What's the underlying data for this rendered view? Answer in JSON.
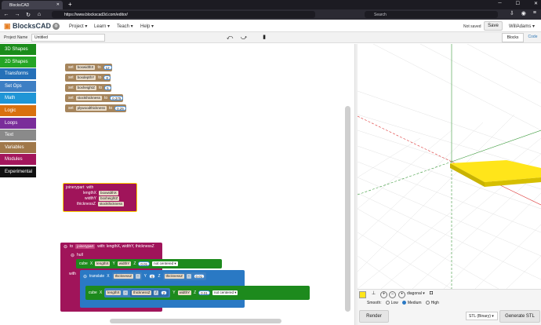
{
  "browser": {
    "tab_title": "BlocksCAD",
    "url": "https://www.blockscad3d.com/editor/",
    "search_placeholder": "Search"
  },
  "app": {
    "logo": "BlocksCAD",
    "menus": [
      "Project ▾",
      "Learn ▾",
      "Teach ▾",
      "Help ▾"
    ],
    "status": "Not saved",
    "save_label": "Save",
    "user": "WillAdams ▾",
    "project_label": "Project Name",
    "project_name": "Untitled",
    "tab_blocks": "Blocks",
    "tab_code": "Code"
  },
  "categories": [
    {
      "label": "3D Shapes",
      "color": "#1a8c1a"
    },
    {
      "label": "2D Shapes",
      "color": "#25a525"
    },
    {
      "label": "Transforms",
      "color": "#2570b8"
    },
    {
      "label": "Set Ops",
      "color": "#3e7fc4"
    },
    {
      "label": "Math",
      "color": "#1f95d6"
    },
    {
      "label": "Logic",
      "color": "#d9710f"
    },
    {
      "label": "Loops",
      "color": "#7a2d9a"
    },
    {
      "label": "Text",
      "color": "#8a8a8a"
    },
    {
      "label": "Variables",
      "color": "#a0784a"
    },
    {
      "label": "Modules",
      "color": "#a3165c"
    },
    {
      "label": "Experimental",
      "color": "#111111"
    }
  ],
  "blocks": {
    "set_word": "set",
    "to_word": "to",
    "with_word": "with",
    "variables": [
      {
        "name": "boxwidthX",
        "value": "12"
      },
      {
        "name": "boxdepthY",
        "value": "8"
      },
      {
        "name": "boxheightZ",
        "value": "5"
      },
      {
        "name": "stockthickness",
        "value": "0.375"
      },
      {
        "name": "plywoodthickness",
        "value": "0.25"
      }
    ],
    "call": {
      "name": "joinerypart",
      "args": [
        {
          "param": "lengthX",
          "value": "boxwidthX"
        },
        {
          "param": "widthY",
          "value": "boxheightZ"
        },
        {
          "param": "thicknessZ",
          "value": "stockthickness"
        }
      ]
    },
    "def": {
      "header_to": "to",
      "name": "joinerypart",
      "params": "with: lengthX, widthY, thicknessZ",
      "hull": "hull",
      "cube": "cube",
      "translate": "translate",
      "x": "X",
      "y": "Y",
      "z": "Z",
      "lengthX": "lengthX",
      "widthY": "widthY",
      "thicknessZ": "thicknessZ",
      "zero": "0",
      "val_001": "0.01",
      "two": "2",
      "centered": "not centered ▾",
      "op_minus": "-",
      "op_div": "/"
    }
  },
  "controls": {
    "view": "diagonal ▾",
    "smooth_label": "Smooth:",
    "smooth_low": "Low",
    "smooth_medium": "Medium",
    "smooth_high": "High",
    "render": "Render",
    "stl_format": "STL (Binary) ▾",
    "generate": "Generate STL",
    "object_color": "#ffe51a"
  }
}
